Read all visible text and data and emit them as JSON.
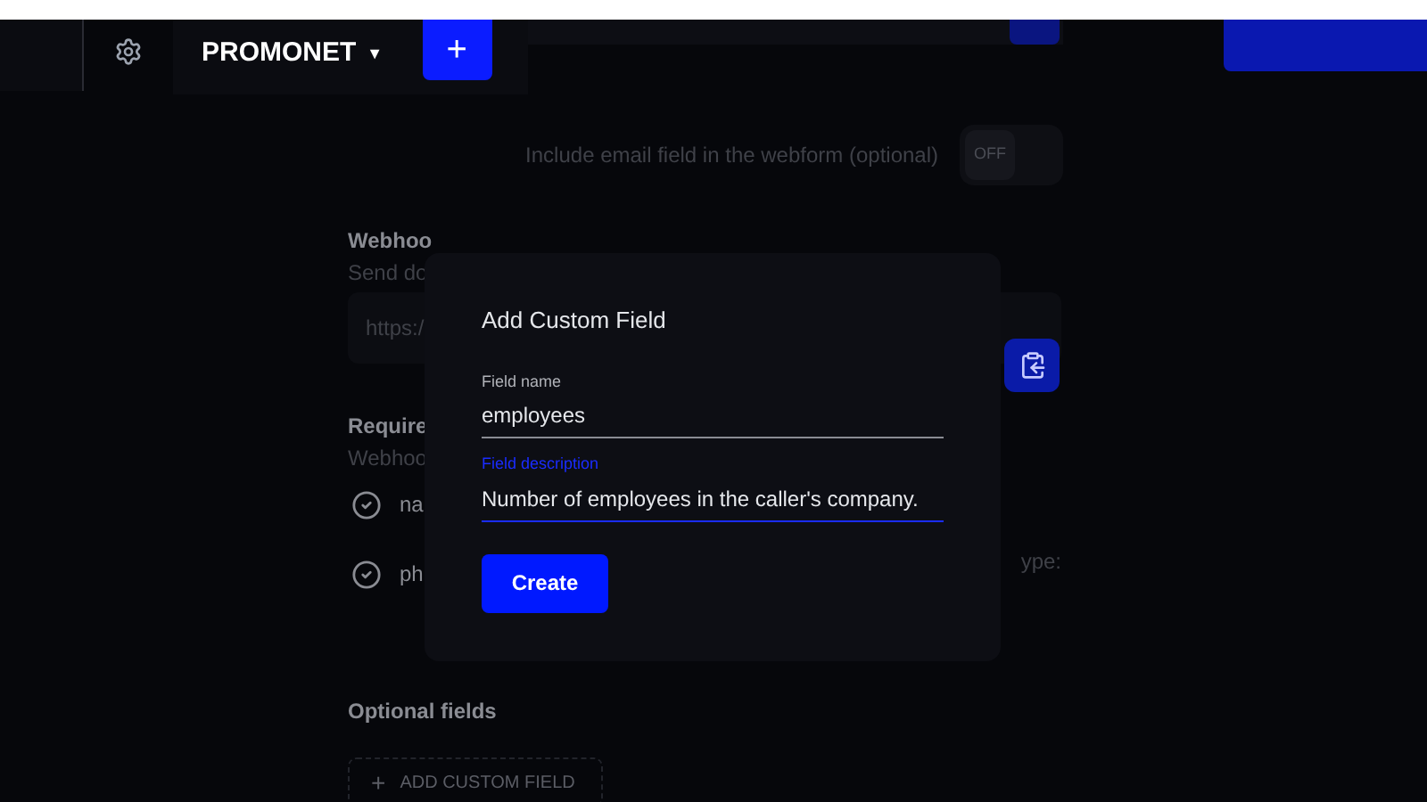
{
  "header": {
    "workspace": "PROMONET",
    "caret": "▼",
    "add_label": "+"
  },
  "email_toggle": {
    "label": "Include email field in the webform (optional)",
    "state": "OFF",
    "on": false
  },
  "webhook": {
    "title": "Webhoo",
    "subtitle": "Send do",
    "url": "https:/"
  },
  "required": {
    "title": "Require",
    "subtitle": "Webhoo",
    "items": [
      {
        "label": "na",
        "checked": true
      },
      {
        "label": "ph",
        "checked": true
      }
    ],
    "side_text": "ype:"
  },
  "optional": {
    "title": "Optional fields",
    "add_button": "ADD CUSTOM FIELD",
    "add_icon": "+"
  },
  "dialog": {
    "title": "Add Custom Field",
    "fields": [
      {
        "label": "Field name",
        "value": "employees",
        "focused": false
      },
      {
        "label": "Field description",
        "value": "Number of employees in the caller's company.",
        "focused": true
      }
    ],
    "button": "Create"
  }
}
